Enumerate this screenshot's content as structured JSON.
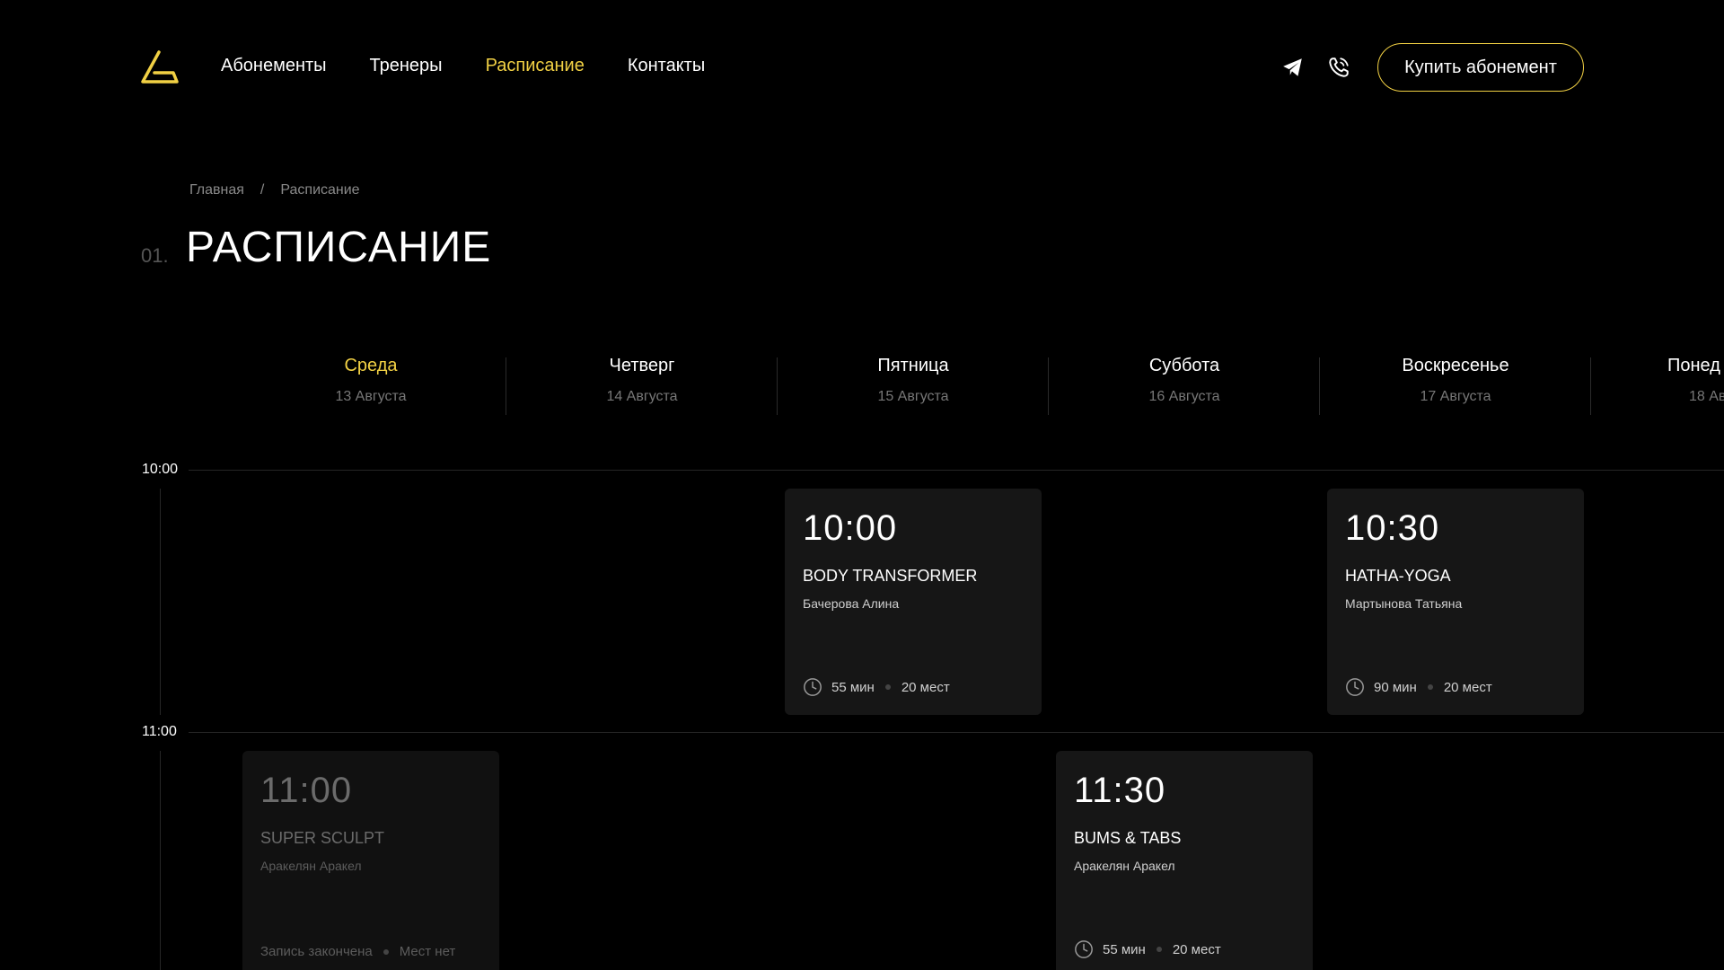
{
  "nav": {
    "items": [
      {
        "label": "Абонементы"
      },
      {
        "label": "Тренеры"
      },
      {
        "label": "Расписание"
      },
      {
        "label": "Контакты"
      }
    ],
    "buy_label": "Купить абонемент"
  },
  "breadcrumb": {
    "home": "Главная",
    "separator": "/",
    "current": "Расписание"
  },
  "section": {
    "number": "01.",
    "title": "РАСПИСАНИЕ"
  },
  "days": [
    {
      "name": "Среда",
      "date": "13 Августа"
    },
    {
      "name": "Четверг",
      "date": "14 Августа"
    },
    {
      "name": "Пятница",
      "date": "15 Августа"
    },
    {
      "name": "Суббота",
      "date": "16 Августа"
    },
    {
      "name": "Воскресенье",
      "date": "17 Августа"
    },
    {
      "name": "Понед",
      "date": "18 Ав"
    }
  ],
  "times": [
    "10:00",
    "11:00"
  ],
  "classes": [
    {
      "time": "10:00",
      "title": "BODY TRANSFORMER",
      "trainer": "Бачерова Алина",
      "duration": "55 мин",
      "places": "20 мест"
    },
    {
      "time": "10:30",
      "title": "HATHA-YOGA",
      "trainer": "Мартынова Татьяна",
      "duration": "90 мин",
      "places": "20 мест"
    },
    {
      "time": "11:00",
      "title": "SUPER SCULPT",
      "trainer": "Аракелян Аракел",
      "status": "Запись закончена",
      "places": "Мест нет"
    },
    {
      "time": "11:30",
      "title": "BUMS & TABS",
      "trainer": "Аракелян Аракел",
      "duration": "55 мин",
      "places": "20 мест"
    }
  ],
  "colors": {
    "accent": "#f1d044",
    "background": "#000000",
    "card": "#161616"
  }
}
